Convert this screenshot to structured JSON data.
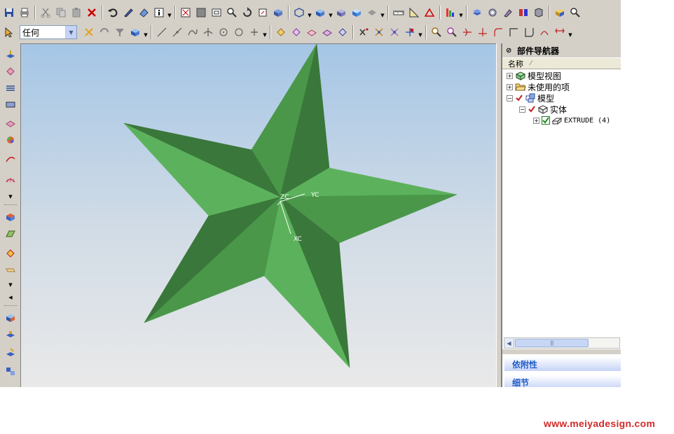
{
  "toolbar": {
    "filter_value": "任何"
  },
  "navigator": {
    "title": "部件导航器",
    "column_name": "名称",
    "items": [
      {
        "label": "模型视图"
      },
      {
        "label": "未使用的项"
      },
      {
        "label": "模型"
      },
      {
        "label": "实体"
      },
      {
        "label": "EXTRUDE (4)"
      }
    ],
    "panels": {
      "dependency": "依附性",
      "detail": "细节"
    }
  },
  "viewport": {
    "axes": {
      "z": "ZC",
      "y": "YC",
      "x": "XC"
    },
    "colors": {
      "model_light": "#5cb25c",
      "model_mid": "#4a974a",
      "model_dark": "#3a773a",
      "axis": "#ffffff"
    }
  },
  "watermark": "www.meiyadesign.com"
}
